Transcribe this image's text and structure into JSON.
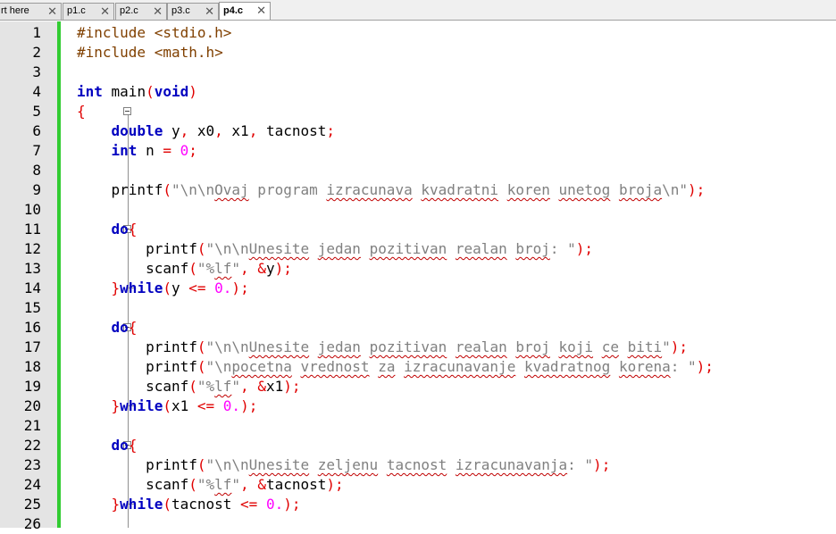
{
  "tabs": [
    {
      "label": "rt here",
      "active": false
    },
    {
      "label": "p1.c",
      "active": false
    },
    {
      "label": "p2.c",
      "active": false
    },
    {
      "label": "p3.c",
      "active": false
    },
    {
      "label": "p4.c",
      "active": true
    }
  ],
  "tab_close_glyph": "✕",
  "line_numbers": [
    "1",
    "2",
    "3",
    "4",
    "5",
    "6",
    "7",
    "8",
    "9",
    "10",
    "11",
    "12",
    "13",
    "14",
    "15",
    "16",
    "17",
    "18",
    "19",
    "20",
    "21",
    "22",
    "23",
    "24",
    "25",
    "26"
  ],
  "code": {
    "l1": {
      "text": "#include <stdio.h>"
    },
    "l2": {
      "text": "#include <math.h>"
    },
    "l4": {
      "kw": "int",
      "name": " main",
      "p1": "(",
      "kw2": "void",
      "p2": ")"
    },
    "l5": {
      "brace": "{"
    },
    "l6": {
      "indent": "    ",
      "kw": "double",
      "a": " y",
      "c1": ",",
      "b": " x0",
      "c2": ",",
      "c": " x1",
      "c3": ",",
      "d": " tacnost",
      "semi": ";"
    },
    "l7": {
      "indent": "    ",
      "kw": "int",
      "a": " n ",
      "eq": "=",
      "sp": " ",
      "num": "0",
      "semi": ";"
    },
    "l9": {
      "indent": "    ",
      "fn": "printf",
      "p1": "(",
      "s1": "\"\\n\\n",
      "w1": "Ovaj",
      "s2": " program ",
      "w2": "izracunava",
      "s3": " ",
      "w3": "kvadratni",
      "s4": " ",
      "w4": "koren",
      "s5": " ",
      "w5": "unetog",
      "s6": " ",
      "w6": "broja",
      "s7": "\\n\"",
      "p2": ")",
      "semi": ";"
    },
    "l11": {
      "indent": "    ",
      "kw": "do",
      "brace": "{"
    },
    "l12": {
      "indent": "        ",
      "fn": "printf",
      "p1": "(",
      "s1": "\"\\n\\n",
      "w1": "Unesite",
      "s2": " ",
      "w2": "jedan",
      "s3": " ",
      "w3": "pozitivan",
      "s4": " ",
      "w4": "realan",
      "s5": " ",
      "w5": "broj",
      "s6": ": \"",
      "p2": ")",
      "semi": ";"
    },
    "l13": {
      "indent": "        ",
      "fn": "scanf",
      "p1": "(",
      "s1": "\"%",
      "w1": "lf",
      "s2": "\"",
      "comma": ",",
      "sp": " ",
      "amp": "&",
      "id": "y",
      "p2": ")",
      "semi": ";"
    },
    "l14": {
      "indent": "    ",
      "brace": "}",
      "kw": "while",
      "p1": "(",
      "id": "y ",
      "op": "<=",
      "sp": " ",
      "num": "0.",
      "p2": ")",
      "semi": ";"
    },
    "l16": {
      "indent": "    ",
      "kw": "do",
      "brace": "{"
    },
    "l17": {
      "indent": "        ",
      "fn": "printf",
      "p1": "(",
      "s1": "\"\\n\\n",
      "w1": "Unesite",
      "s2": " ",
      "w2": "jedan",
      "s3": " ",
      "w3": "pozitivan",
      "s4": " ",
      "w4": "realan",
      "s5": " ",
      "w5": "broj",
      "s6": " ",
      "w6": "koji",
      "s7": " ",
      "w7": "ce",
      "s8": " ",
      "w8": "biti",
      "s9": "\"",
      "p2": ")",
      "semi": ";"
    },
    "l18": {
      "indent": "        ",
      "fn": "printf",
      "p1": "(",
      "s1": "\"\\n",
      "w1": "pocetna",
      "s2": " ",
      "w2": "vrednost",
      "s3": " ",
      "w3": "za",
      "s4": " ",
      "w4": "izracunavanje",
      "s5": " ",
      "w5": "kvadratnog",
      "s6": " ",
      "w6": "korena",
      "s7": ": \"",
      "p2": ")",
      "semi": ";"
    },
    "l19": {
      "indent": "        ",
      "fn": "scanf",
      "p1": "(",
      "s1": "\"%",
      "w1": "lf",
      "s2": "\"",
      "comma": ",",
      "sp": " ",
      "amp": "&",
      "id": "x1",
      "p2": ")",
      "semi": ";"
    },
    "l20": {
      "indent": "    ",
      "brace": "}",
      "kw": "while",
      "p1": "(",
      "id": "x1 ",
      "op": "<=",
      "sp": " ",
      "num": "0.",
      "p2": ")",
      "semi": ";"
    },
    "l22": {
      "indent": "    ",
      "kw": "do",
      "brace": "{"
    },
    "l23": {
      "indent": "        ",
      "fn": "printf",
      "p1": "(",
      "s1": "\"\\n\\n",
      "w1": "Unesite",
      "s2": " ",
      "w2": "zeljenu",
      "s3": " ",
      "w3": "tacnost",
      "s4": " ",
      "w4": "izracunavanja",
      "s5": ": \"",
      "p2": ")",
      "semi": ";"
    },
    "l24": {
      "indent": "        ",
      "fn": "scanf",
      "p1": "(",
      "s1": "\"%",
      "w1": "lf",
      "s2": "\"",
      "comma": ",",
      "sp": " ",
      "amp": "&",
      "id": "tacnost",
      "p2": ")",
      "semi": ";"
    },
    "l25": {
      "indent": "    ",
      "brace": "}",
      "kw": "while",
      "p1": "(",
      "id": "tacnost ",
      "op": "<=",
      "sp": " ",
      "num": "0.",
      "p2": ")",
      "semi": ";"
    }
  },
  "colors": {
    "preprocessor": "#804000",
    "keyword": "#0000c0",
    "operator": "#e00000",
    "string": "#808080",
    "number": "#ff00ff",
    "change_bar": "#32cc32",
    "gutter": "#e4e4e4"
  }
}
